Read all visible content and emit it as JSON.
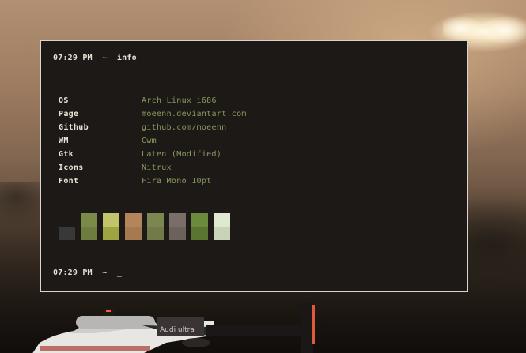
{
  "terminal": {
    "top_prompt": {
      "time": "07:29 PM",
      "separator": "~",
      "command": "info"
    },
    "bottom_prompt": {
      "time": "07:29 PM",
      "separator": "~",
      "cursor": "_"
    },
    "info": [
      {
        "key": "OS",
        "value": "Arch Linux i686"
      },
      {
        "key": "Page",
        "value": "moeenn.deviantart.com"
      },
      {
        "key": "Github",
        "value": "github.com/moeenn"
      },
      {
        "key": "WM",
        "value": "Cwm"
      },
      {
        "key": "Gtk",
        "value": "Laten (Modified)"
      },
      {
        "key": "Icons",
        "value": "Nitrux"
      },
      {
        "key": "Font",
        "value": "Fira Mono 10pt"
      }
    ],
    "palette": [
      {
        "top": "#383838",
        "bottom": "#383838",
        "short": true
      },
      {
        "top": "#7b8a48",
        "bottom": "#6e7d3f"
      },
      {
        "top": "#c1c46a",
        "bottom": "#9ca540"
      },
      {
        "top": "#b2865a",
        "bottom": "#a57a52"
      },
      {
        "top": "#7c8650",
        "bottom": "#717a48"
      },
      {
        "top": "#7a6e68",
        "bottom": "#6c625c"
      },
      {
        "top": "#6c8a3c",
        "bottom": "#5a7432"
      },
      {
        "top": "#dfe8d0",
        "bottom": "#c8d4b8"
      }
    ]
  }
}
